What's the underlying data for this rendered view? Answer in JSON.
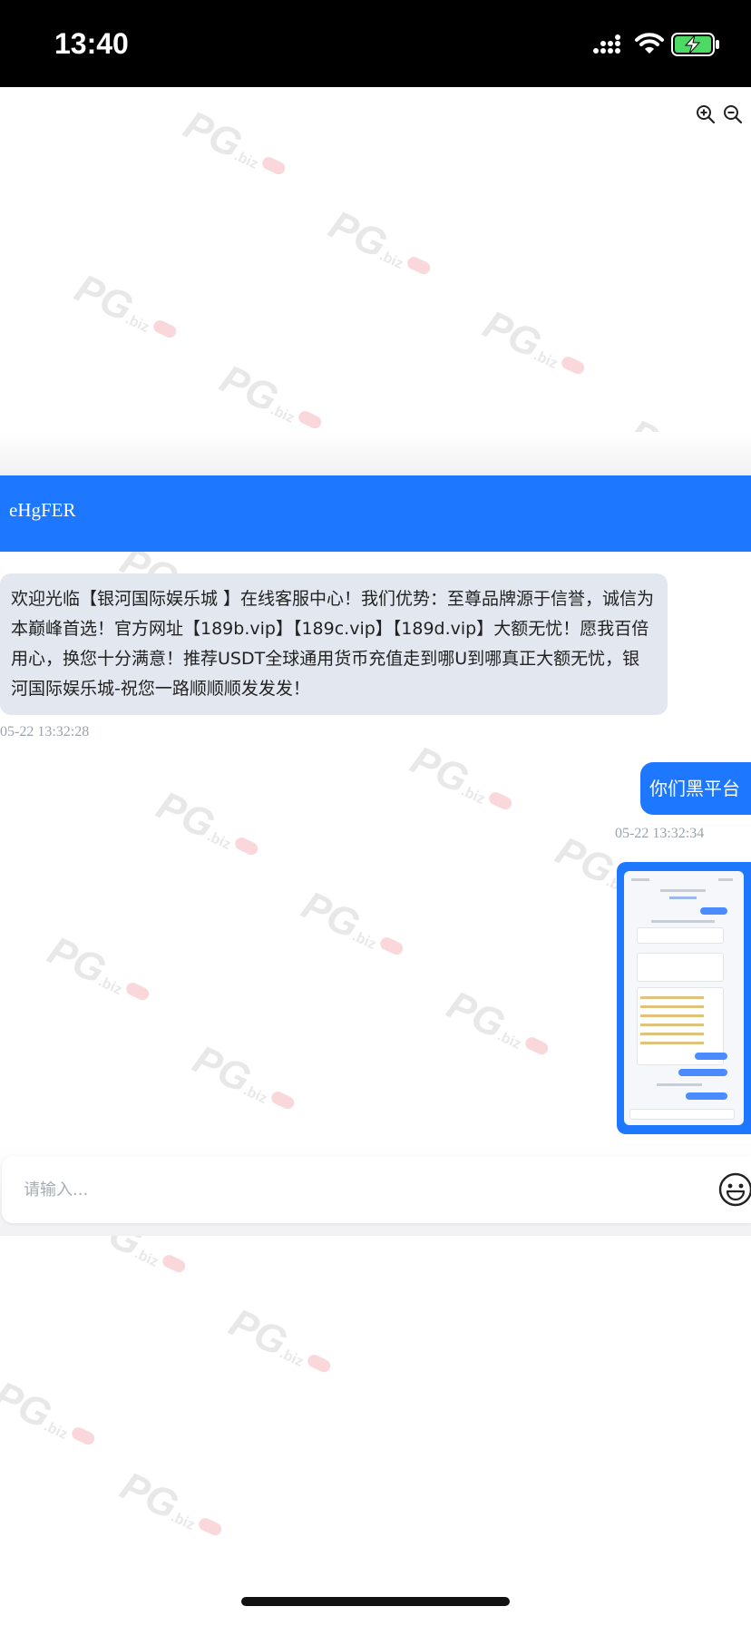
{
  "status_bar": {
    "time": "13:40"
  },
  "chat": {
    "title": "eHgFER",
    "input_placeholder": "请输入...",
    "messages": [
      {
        "direction": "incoming",
        "text": "欢迎光临【银河国际娱乐城 】在线客服中心！我们优势：至尊品牌源于信誉，诚信为本巅峰首选！官方网址【189b.vip】【189c.vip】【189d.vip】大额无忧！愿我百倍用心，换您十分满意！推荐USDT全球通用货币充值走到哪U到哪真正大额无忧，银河国际娱乐城-祝您一路顺顺顺发发发！",
        "timestamp": "05-22 13:32:28"
      },
      {
        "direction": "outgoing",
        "text": "你们黑平台",
        "timestamp": "05-22 13:32:34"
      },
      {
        "direction": "outgoing",
        "type": "image",
        "content": "screenshot-thumbnail"
      }
    ]
  },
  "colors": {
    "accent": "#1e78ff",
    "incoming_bubble": "#e3e8f0",
    "timestamp": "#9aa3ad",
    "status_bar": "#000000",
    "battery_fill": "#4cd964"
  },
  "icons": {
    "signal": "signal-icon",
    "wifi": "wifi-icon",
    "battery": "battery-charging-icon",
    "zoom_in": "zoom-in-icon",
    "zoom_out": "zoom-out-icon",
    "emoji": "emoji-icon"
  }
}
